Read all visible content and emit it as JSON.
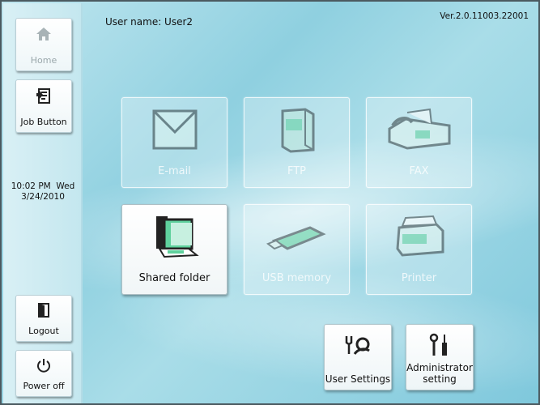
{
  "header": {
    "user_label": "User name: User2",
    "version": "Ver.2.0.11003.22001"
  },
  "sidebar": {
    "home_label": "Home",
    "job_label": "Job Button",
    "clock_time": "10:02 PM  Wed",
    "clock_date": "3/24/2010",
    "logout_label": "Logout",
    "power_label": "Power off"
  },
  "tiles": {
    "email_label": "E-mail",
    "ftp_label": "FTP",
    "fax_label": "FAX",
    "shared_label": "Shared folder",
    "usb_label": "USB memory",
    "printer_label": "Printer"
  },
  "bottom": {
    "user_settings_label": "User Settings",
    "admin_label": "Administrator setting"
  },
  "colors": {
    "accent_green": "#6fd9a8",
    "icon_dark": "#3a3f42"
  }
}
